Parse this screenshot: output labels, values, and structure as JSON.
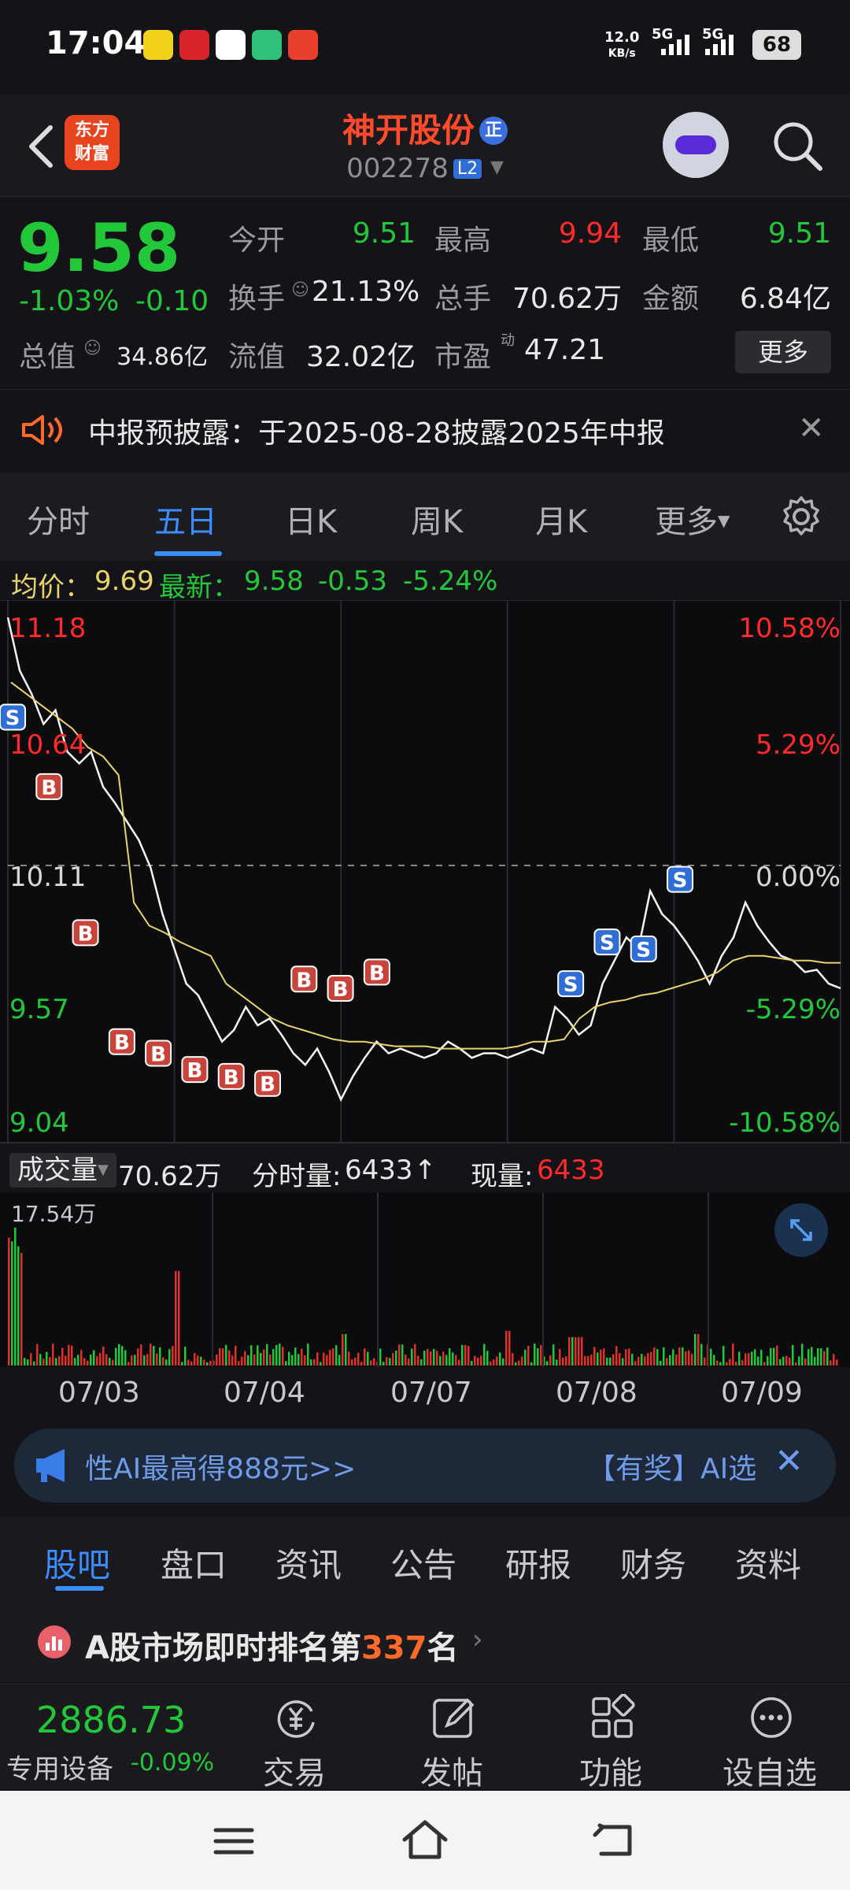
{
  "status_bar": {
    "time": "17:04",
    "net_speed": "12.0",
    "net_unit": "KB/s",
    "sim1": "5G",
    "sim2": "5G",
    "battery": "68"
  },
  "header": {
    "logo_line1": "东方",
    "logo_line2": "财富",
    "stock_name": "神开股份",
    "stock_badge": "正",
    "stock_code": "002278",
    "level_badge": "L2"
  },
  "quote": {
    "price": "9.58",
    "change_pct": "-1.03%",
    "change_val": "-0.10",
    "open_label": "今开",
    "open_value": "9.51",
    "high_label": "最高",
    "high_value": "9.94",
    "low_label": "最低",
    "low_value": "9.51",
    "turnover_label": "换手",
    "turnover_value": "21.13%",
    "volume_label": "总手",
    "volume_value": "70.62万",
    "amount_label": "金额",
    "amount_value": "6.84亿",
    "mktcap_label": "总值",
    "mktcap_value": "34.86亿",
    "float_label": "流值",
    "float_value": "32.02亿",
    "pe_label": "市盈",
    "pe_sup": "动",
    "pe_value": "47.21",
    "more_button": "更多"
  },
  "notice": {
    "text": "中报预披露：于2025-08-28披露2025年中报"
  },
  "chart_tabs": [
    "分时",
    "五日",
    "日K",
    "周K",
    "月K",
    "更多"
  ],
  "active_chart_tab": "五日",
  "avg_bar": {
    "avg_label": "均价：",
    "avg_value": "9.69",
    "latest_label": "最新：",
    "latest_value": "9.58",
    "latest_change": "-0.53",
    "latest_pct": "-5.24%"
  },
  "colors": {
    "up": "#ff2a2a",
    "down": "#22c83a",
    "accent": "#3a8cff",
    "avg_line": "#e8d46a",
    "brand": "#e94420"
  },
  "chart_data": {
    "type": "line",
    "y_ticks_left": [
      "11.18",
      "10.64",
      "10.11",
      "9.57",
      "9.04"
    ],
    "y_ticks_right": [
      "10.58%",
      "5.29%",
      "0.00%",
      "-5.29%",
      "-10.58%"
    ],
    "ylim": [
      9.04,
      11.18
    ],
    "prev_close": 10.11,
    "x": [
      "07/03",
      "07/04",
      "07/07",
      "07/08",
      "07/09"
    ],
    "series": [
      {
        "values": [
          11.18,
          10.95,
          10.85,
          10.72,
          10.78,
          10.6,
          10.55,
          10.6,
          10.45,
          10.38,
          10.3,
          10.22,
          10.1,
          9.9,
          9.75,
          9.6,
          9.55,
          9.45,
          9.35,
          9.4,
          9.5,
          9.42,
          9.45,
          9.38,
          9.3,
          9.25,
          9.32,
          9.22,
          9.1,
          9.2,
          9.28,
          9.35,
          9.3,
          9.32,
          9.3,
          9.28,
          9.3,
          9.35,
          9.32,
          9.28,
          9.3,
          9.3,
          9.28,
          9.3,
          9.32,
          9.3,
          9.5,
          9.45,
          9.38,
          9.42,
          9.6,
          9.7,
          9.8,
          9.75,
          10.0,
          9.9,
          9.85,
          9.78,
          9.7,
          9.6,
          9.72,
          9.8,
          9.95,
          9.85,
          9.78,
          9.72,
          9.7,
          9.65,
          9.66,
          9.6,
          9.58
        ]
      },
      {
        "values": [
          10.9,
          10.85,
          10.8,
          10.75,
          10.7,
          10.62,
          10.58,
          10.5,
          9.95,
          9.85,
          9.82,
          9.78,
          9.75,
          9.72,
          9.6,
          9.55,
          9.5,
          9.45,
          9.42,
          9.4,
          9.38,
          9.36,
          9.35,
          9.35,
          9.34,
          9.33,
          9.33,
          9.33,
          9.32,
          9.32,
          9.32,
          9.32,
          9.32,
          9.33,
          9.35,
          9.35,
          9.36,
          9.45,
          9.5,
          9.52,
          9.53,
          9.55,
          9.56,
          9.58,
          9.6,
          9.62,
          9.65,
          9.7,
          9.72,
          9.72,
          9.71,
          9.7,
          9.7,
          9.69,
          9.69
        ]
      }
    ],
    "trade_marks": [
      {
        "label": "S",
        "value": 10.75
      },
      {
        "label": "B",
        "value": 10.45
      },
      {
        "label": "B",
        "value": 9.82
      },
      {
        "label": "B",
        "value": 9.35
      },
      {
        "label": "B",
        "value": 9.3
      },
      {
        "label": "B",
        "value": 9.23
      },
      {
        "label": "B",
        "value": 9.2
      },
      {
        "label": "B",
        "value": 9.17
      },
      {
        "label": "B",
        "value": 9.62
      },
      {
        "label": "B",
        "value": 9.58
      },
      {
        "label": "B",
        "value": 9.65
      },
      {
        "label": "S",
        "value": 9.6
      },
      {
        "label": "S",
        "value": 9.78
      },
      {
        "label": "S",
        "value": 9.75
      },
      {
        "label": "S",
        "value": 10.05
      }
    ],
    "grid": true
  },
  "volume": {
    "label": "成交量",
    "total": "70.62万",
    "tick_label": "分时量:",
    "tick_value": "6433",
    "tick_arrow": "↑",
    "now_label": "现量:",
    "now_value": "6433",
    "y_max_label": "17.54万"
  },
  "ad": {
    "text_left": "性AI最高得888元>>",
    "text_right": "【有奖】AI选"
  },
  "sub_tabs": [
    "股吧",
    "盘口",
    "资讯",
    "公告",
    "研报",
    "财务",
    "资料"
  ],
  "active_sub_tab": "股吧",
  "rank": {
    "prefix": "A股市场即时排名第",
    "number": "337",
    "suffix": "名"
  },
  "bottom": {
    "index_value": "2886.73",
    "index_name": "专用设备",
    "index_pct": "-0.09%",
    "btn_trade": "交易",
    "btn_post": "发帖",
    "btn_func": "功能",
    "btn_watch": "设自选"
  }
}
